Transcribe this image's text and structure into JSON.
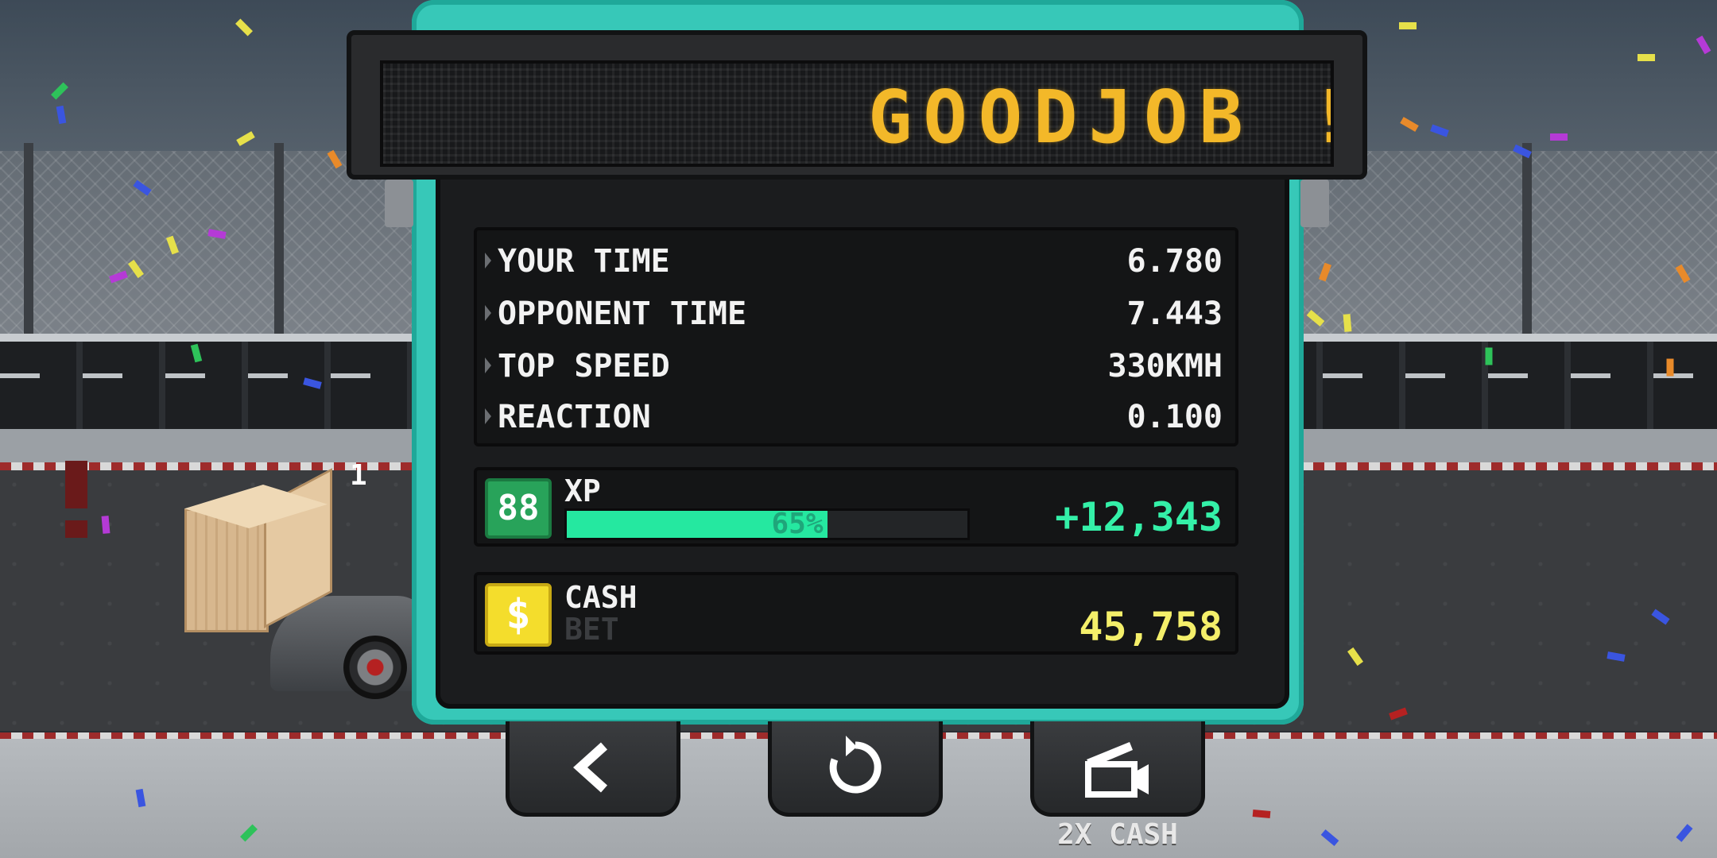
{
  "scoreboard": {
    "message": "GOODJOB !"
  },
  "race": {
    "position": "1"
  },
  "stats": [
    {
      "label": "YOUR TIME",
      "value": "6.780"
    },
    {
      "label": "OPPONENT TIME",
      "value": "7.443"
    },
    {
      "label": "TOP SPEED",
      "value": "330KMH"
    },
    {
      "label": "REACTION",
      "value": "0.100"
    }
  ],
  "xp": {
    "level": "88",
    "label": "XP",
    "progress_percent": 65,
    "progress_text": "65%",
    "gain": "+12,343"
  },
  "cash": {
    "icon": "dollar-coin-icon",
    "label": "CASH",
    "sub_label": "BET",
    "value": "45,758"
  },
  "buttons": {
    "back_icon": "back-arrow-icon",
    "retry_icon": "retry-icon",
    "video_icon": "video-camera-icon",
    "double_cash_label": "2X CASH"
  },
  "colors": {
    "panel_teal": "#37c8b8",
    "led_amber": "#f3b829",
    "xp_green": "#34f0a8",
    "cash_yellow": "#f4ef6a"
  }
}
